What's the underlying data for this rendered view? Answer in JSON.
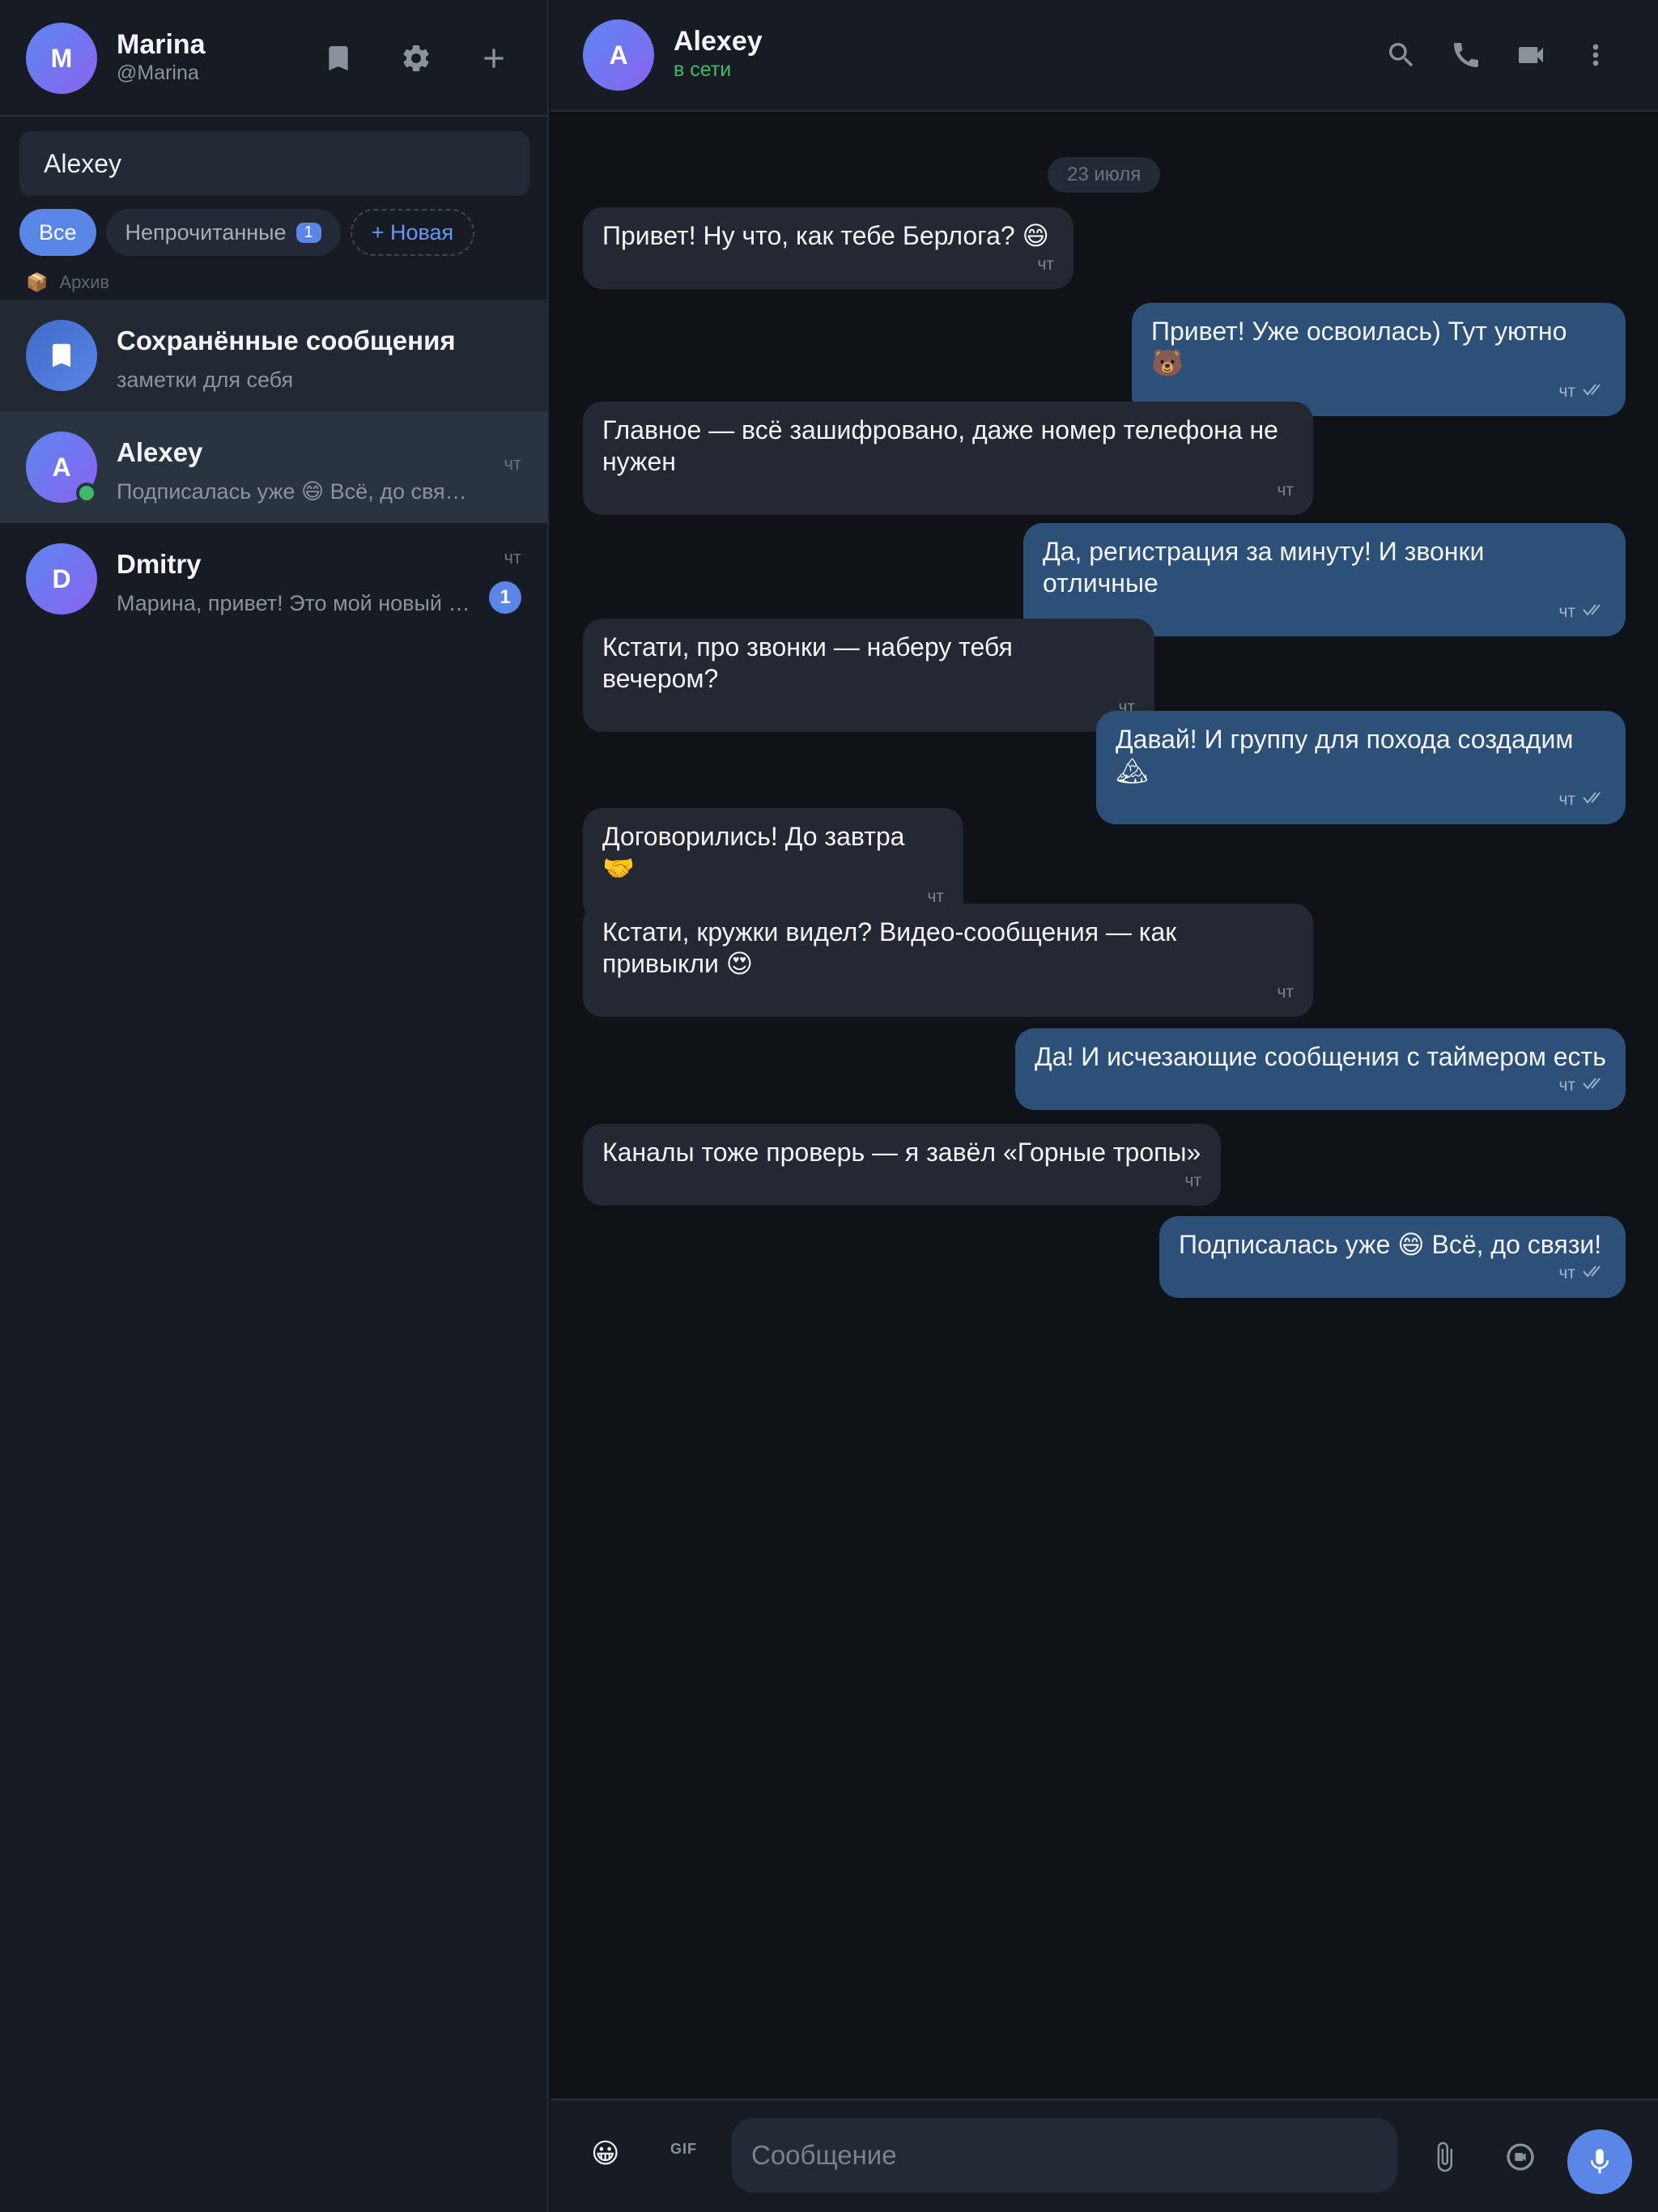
{
  "profile": {
    "initial": "M",
    "name": "Marina",
    "handle": "@Marina"
  },
  "search": {
    "value": "Alexey",
    "placeholder": ""
  },
  "filters": {
    "all": "Все",
    "unread": "Непрочитанные",
    "unread_count": "1",
    "new": "+ Новая"
  },
  "archive": {
    "label": "Архив"
  },
  "chats": [
    {
      "title": "Сохранённые сообщения",
      "preview": "заметки для себя"
    },
    {
      "initial": "A",
      "title": "Alexey",
      "preview": "Подписалась уже 😄 Всё, до связи!",
      "time": "чт"
    },
    {
      "initial": "D",
      "title": "Dmitry",
      "preview": "Марина, привет! Это мой новый н…",
      "time": "чт",
      "unread": "1"
    }
  ],
  "header": {
    "initial": "A",
    "name": "Alexey",
    "status": "в сети"
  },
  "date_separator": "23 июля",
  "messages": [
    {
      "dir": "in",
      "text": "Привет! Ну что, как тебе Берлога? 😄",
      "time": "чт"
    },
    {
      "dir": "out",
      "text": "Привет! Уже освоилась) Тут уютно 🐻",
      "time": "чт"
    },
    {
      "dir": "in",
      "text": "Главное — всё зашифровано, даже номер телефона не нужен",
      "time": "чт"
    },
    {
      "dir": "out",
      "text": "Да, регистрация за минуту! И звонки отличные",
      "time": "чт"
    },
    {
      "dir": "in",
      "text": "Кстати, про звонки — наберу тебя вечером?",
      "time": "чт"
    },
    {
      "dir": "out",
      "text": "Давай! И группу для похода создадим 🏔",
      "time": "чт"
    },
    {
      "dir": "in",
      "text": "Договорились! До завтра 🤝",
      "time": "чт"
    },
    {
      "dir": "in",
      "text": "Кстати, кружки видел? Видео-сообщения — как привыкли 😍",
      "time": "чт"
    },
    {
      "dir": "out",
      "text": "Да! И исчезающие сообщения с таймером есть",
      "time": "чт"
    },
    {
      "dir": "in",
      "text": "Каналы тоже проверь — я завёл «Горные тропы»",
      "time": "чт"
    },
    {
      "dir": "out",
      "text": "Подписалась уже 😄 Всё, до связи!",
      "time": "чт"
    }
  ],
  "composer": {
    "placeholder": "Сообщение",
    "gif": "GIF"
  },
  "colors": {
    "accent": "#5a86e8",
    "outgoing_bubble": "#2c5078",
    "incoming_bubble": "#232833",
    "online": "#3fb96a"
  }
}
